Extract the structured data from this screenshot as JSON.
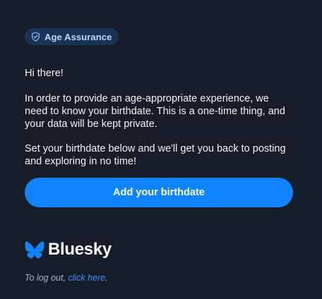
{
  "badge": {
    "label": "Age Assurance",
    "icon": "shield-check-icon"
  },
  "message": {
    "greeting": "Hi there!",
    "paragraph_1": "In order to provide an age-appropriate experience, we need to know your birthdate. This is a one-time thing, and your data will be kept private.",
    "paragraph_2": "Set your birthdate below and we'll get you back to posting and exploring in no time!"
  },
  "cta": {
    "label": "Add your birthdate"
  },
  "brand": {
    "name": "Bluesky",
    "icon": "butterfly-logo-icon"
  },
  "footer": {
    "logout_prefix": "To log out, ",
    "logout_link": "click here",
    "logout_suffix": "."
  },
  "colors": {
    "background": "#151d28",
    "accent": "#1083fe",
    "badge_bg": "#1b3357",
    "link": "#3b8fff"
  }
}
